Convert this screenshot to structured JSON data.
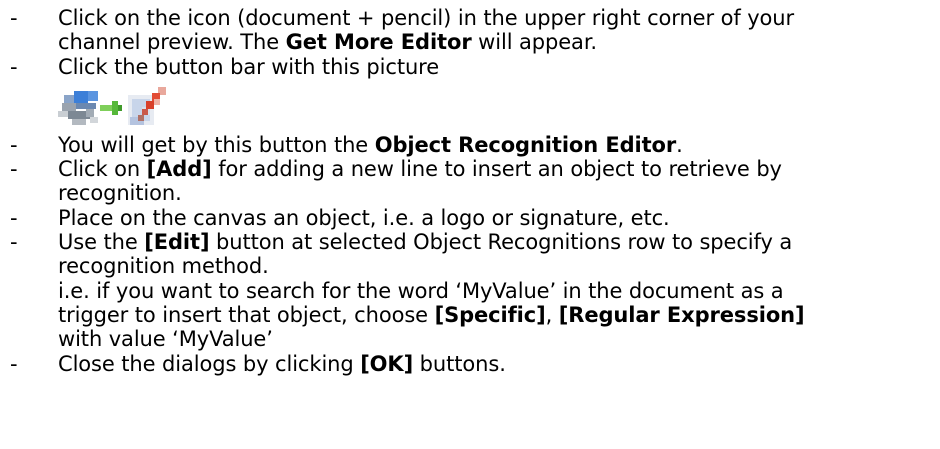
{
  "bullet": "-",
  "items": [
    {
      "lines": [
        [
          "Click on the icon (document + pencil) in the upper right corner of your"
        ],
        [
          "channel preview. The ",
          {
            "b": "Get More Editor"
          },
          " will appear."
        ]
      ]
    },
    {
      "lines": [
        [
          "Click the button bar with this picture"
        ]
      ],
      "picture": "object-recognition-button-icon"
    },
    {
      "lines": [
        [
          "You will get by this button the ",
          {
            "b": "Object Recognition Editor"
          },
          "."
        ]
      ]
    },
    {
      "lines": [
        [
          "Click on ",
          {
            "b": "[Add]"
          },
          " for adding a new line to insert an object to retrieve by"
        ],
        [
          "recognition."
        ]
      ]
    },
    {
      "lines": [
        [
          "Place on the canvas an object, i.e. a logo or signature, etc."
        ]
      ]
    },
    {
      "lines": [
        [
          "Use the ",
          {
            "b": "[Edit]"
          },
          " button at selected Object Recognitions row to specify a"
        ],
        [
          "recognition method."
        ],
        [
          "i.e. if you want to search for the word ‘MyValue’ in the document as a"
        ],
        [
          "trigger to insert that object, choose ",
          {
            "b": "[Specific]"
          },
          ", ",
          {
            "b": "[Regular Expression]"
          }
        ],
        [
          "with value ‘MyValue’"
        ]
      ]
    },
    {
      "lines": [
        [
          "Close the dialogs by clicking ",
          {
            "b": "[OK]"
          },
          " buttons."
        ]
      ]
    }
  ]
}
